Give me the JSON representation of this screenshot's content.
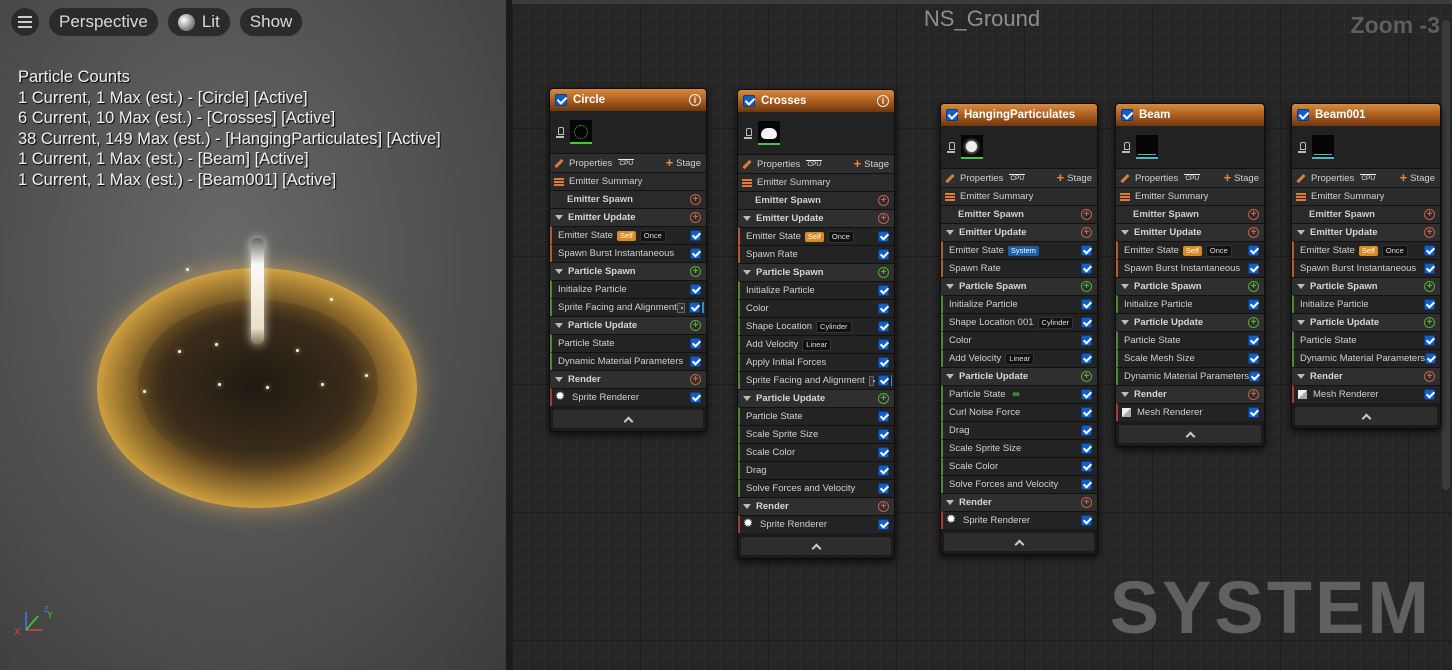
{
  "viewport": {
    "menu_icon": "hamburger-icon",
    "perspective_label": "Perspective",
    "lit_label": "Lit",
    "show_label": "Show",
    "particle_counts_title": "Particle Counts",
    "counts": [
      "1 Current, 1 Max (est.) - [Circle] [Active]",
      "6 Current, 10 Max (est.) - [Crosses] [Active]",
      "38 Current, 149 Max (est.) - [HangingParticulates] [Active]",
      "1 Current, 1 Max (est.) - [Beam] [Active]",
      "1 Current, 1 Max (est.) - [Beam001] [Active]"
    ],
    "axis": {
      "x": "X",
      "z": "Z",
      "y": "Y"
    }
  },
  "graph": {
    "title": "NS_Ground",
    "zoom": "Zoom -3",
    "watermark": "SYSTEM",
    "common": {
      "properties": "Properties",
      "cpu": "CPU",
      "stage": "Stage",
      "emitter_summary": "Emitter Summary",
      "emitter_spawn": "Emitter Spawn",
      "emitter_update": "Emitter Update",
      "particle_spawn": "Particle Spawn",
      "particle_update": "Particle Update",
      "render": "Render",
      "self": "Self",
      "once": "Once",
      "system": "System",
      "cylinder": "Cylinder",
      "linear": "Linear"
    },
    "colors": {
      "header_orange": "#c7702c",
      "checkbox_blue": "#1160c8",
      "self_badge": "#d88b22"
    },
    "emitters": {
      "circle": {
        "name": "Circle",
        "emitter_update": [
          "Emitter State",
          "Spawn Burst Instantaneous"
        ],
        "particle_spawn": [
          "Initialize Particle",
          "Sprite Facing and Alignment"
        ],
        "particle_update": [
          "Particle State",
          "Dynamic Material Parameters"
        ],
        "render": "Sprite Renderer"
      },
      "crosses": {
        "name": "Crosses",
        "emitter_update": [
          "Emitter State",
          "Spawn Rate"
        ],
        "particle_spawn": [
          "Initialize Particle",
          "Color",
          "Shape Location",
          "Add Velocity",
          "Apply Initial Forces",
          "Sprite Facing and Alignment"
        ],
        "particle_update": [
          "Particle State",
          "Scale Sprite Size",
          "Scale Color",
          "Drag",
          "Solve Forces and Velocity"
        ],
        "render": "Sprite Renderer"
      },
      "hanging": {
        "name": "HangingParticulates",
        "emitter_update": [
          "Emitter State",
          "Spawn Rate"
        ],
        "particle_spawn": [
          "Initialize Particle",
          "Shape Location 001",
          "Color",
          "Add Velocity"
        ],
        "particle_update": [
          "Particle State",
          "Curl Noise Force",
          "Drag",
          "Scale Sprite Size",
          "Scale Color",
          "Solve Forces and Velocity"
        ],
        "render": "Sprite Renderer"
      },
      "beam": {
        "name": "Beam",
        "emitter_update": [
          "Emitter State",
          "Spawn Burst Instantaneous"
        ],
        "particle_spawn": [
          "Initialize Particle"
        ],
        "particle_update": [
          "Particle State",
          "Scale Mesh Size",
          "Dynamic Material Parameters"
        ],
        "render": "Mesh Renderer"
      },
      "beam001": {
        "name": "Beam001",
        "emitter_update": [
          "Emitter State",
          "Spawn Burst Instantaneous"
        ],
        "particle_spawn": [
          "Initialize Particle"
        ],
        "particle_update": [
          "Particle State",
          "Dynamic Material Parameters"
        ],
        "render": "Mesh Renderer"
      }
    }
  }
}
